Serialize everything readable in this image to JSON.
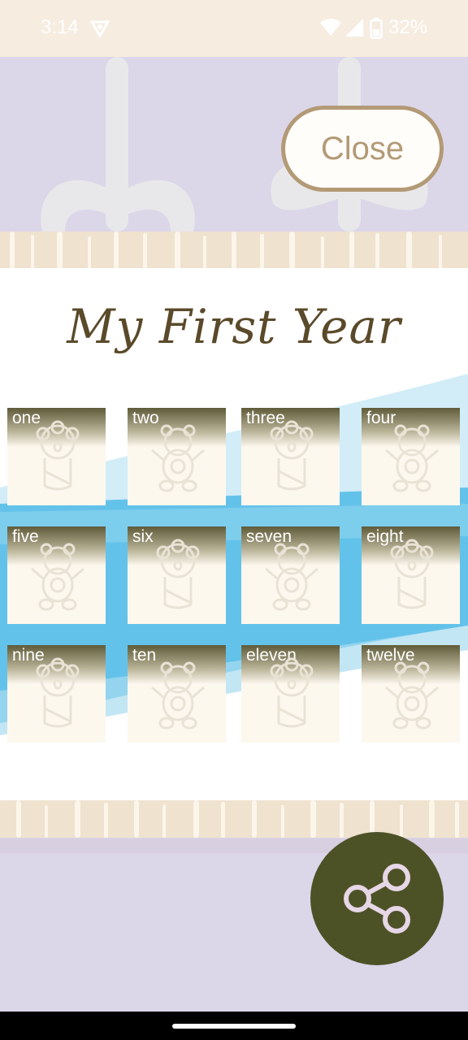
{
  "status_bar": {
    "time": "3:14",
    "battery": "32%",
    "icons": [
      "vpn-icon",
      "wifi-icon",
      "signal-icon",
      "battery-icon"
    ]
  },
  "close_button": {
    "label": "Close"
  },
  "title": "My First Year",
  "months": [
    {
      "label": "one",
      "icon": "baby-icon"
    },
    {
      "label": "two",
      "icon": "teddy-bear-icon"
    },
    {
      "label": "three",
      "icon": "baby-icon"
    },
    {
      "label": "four",
      "icon": "teddy-bear-icon"
    },
    {
      "label": "five",
      "icon": "teddy-bear-icon"
    },
    {
      "label": "six",
      "icon": "baby-icon"
    },
    {
      "label": "seven",
      "icon": "teddy-bear-icon"
    },
    {
      "label": "eight",
      "icon": "baby-icon"
    },
    {
      "label": "nine",
      "icon": "baby-icon"
    },
    {
      "label": "ten",
      "icon": "teddy-bear-icon"
    },
    {
      "label": "eleven",
      "icon": "baby-icon"
    },
    {
      "label": "twelve",
      "icon": "teddy-bear-icon"
    }
  ],
  "share_button": {
    "icon": "share-icon"
  },
  "colors": {
    "background": "#dcd6e9",
    "accent": "#4d5226",
    "close_border": "#b39a76",
    "title": "#5a4a2a",
    "brush": "#6ec8ea"
  }
}
